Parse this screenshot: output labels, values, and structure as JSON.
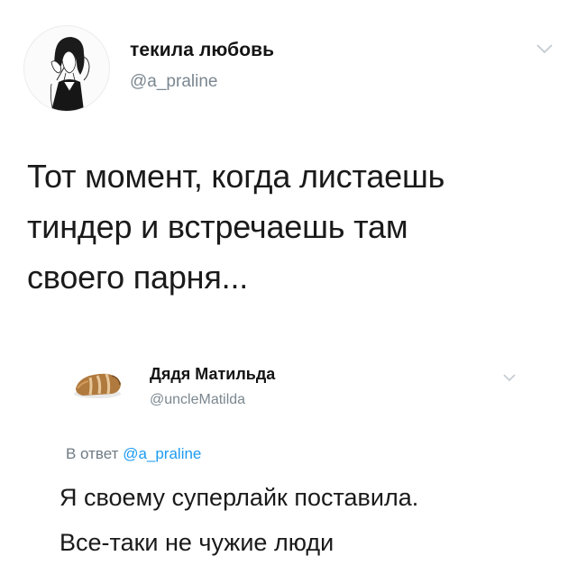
{
  "tweet": {
    "author_name": "текила любовь",
    "author_handle": "@a_praline",
    "text_lines": [
      "Тот момент, когда листаешь",
      "тиндер и встречаешь там",
      "своего парня..."
    ]
  },
  "reply": {
    "author_name": "Дядя Матильда",
    "author_handle": "@uncleMatilda",
    "reply_prefix": "В ответ",
    "reply_mention": "@a_praline",
    "text_lines": [
      "Я своему суперлайк поставила.",
      "Все-таки не чужие люди"
    ]
  },
  "icons": {
    "tweet_avatar": "woman-sketch-avatar",
    "reply_avatar": "bread-loaf-avatar",
    "menu": "chevron-down-icon"
  },
  "colors": {
    "handle": "#7b8790",
    "mention": "#1d9bf0",
    "chevron": "#c3cbd1"
  }
}
